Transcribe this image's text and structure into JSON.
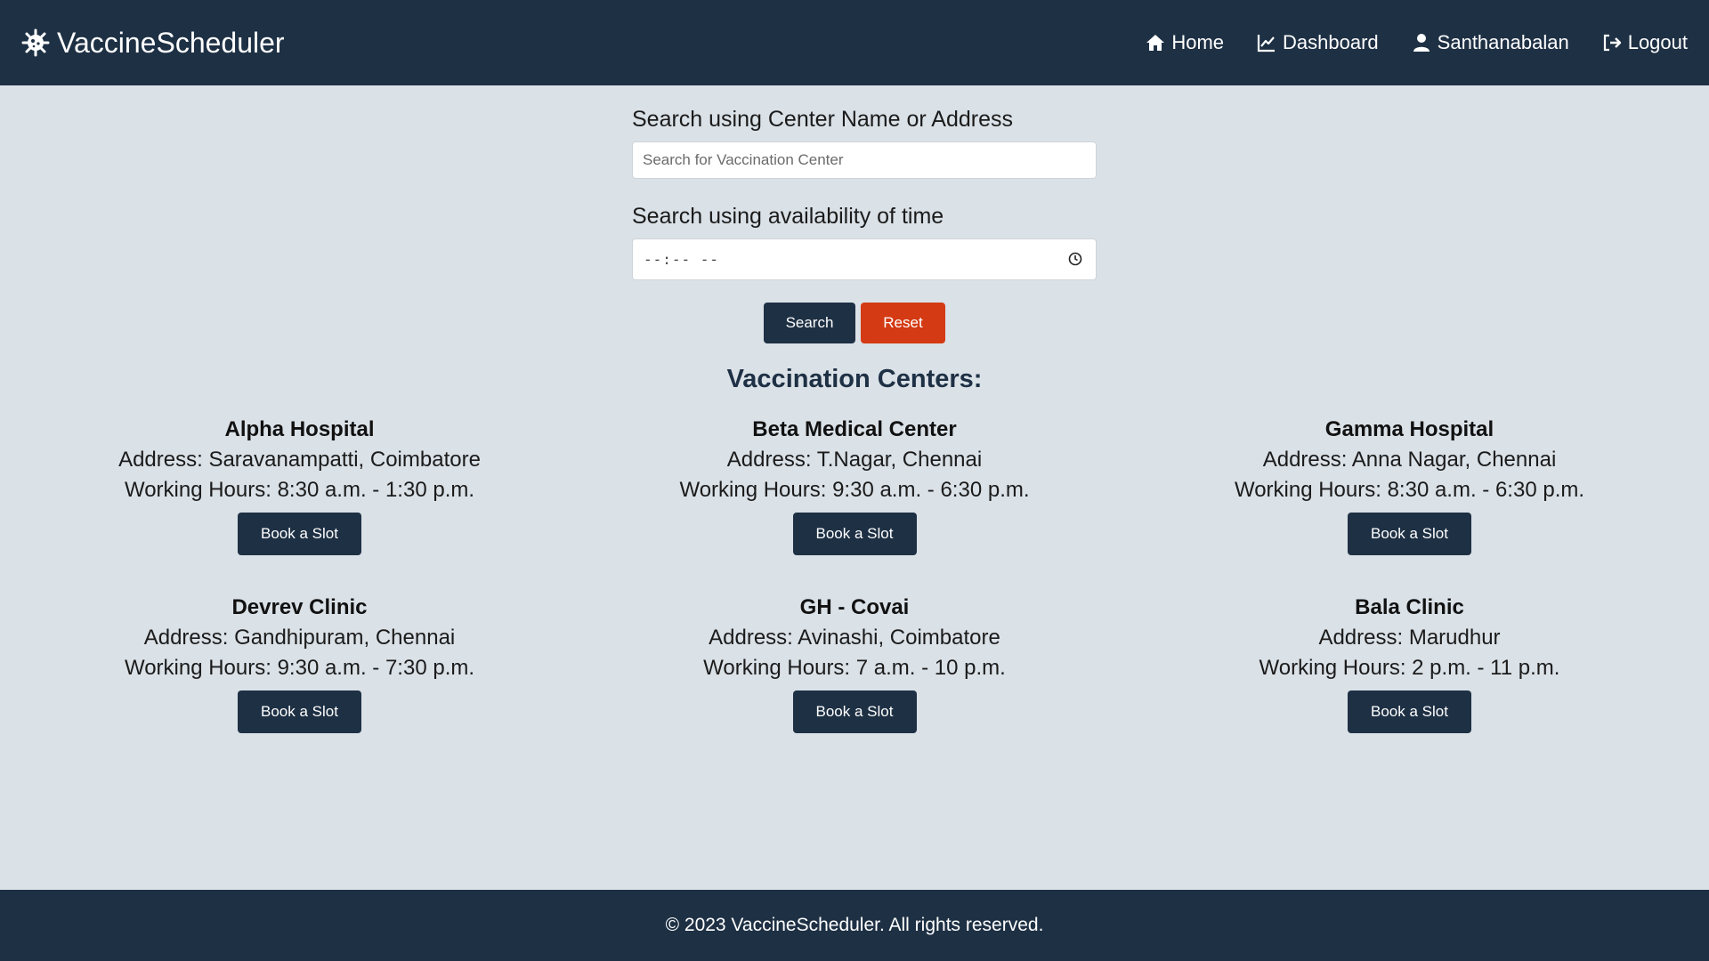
{
  "brand": {
    "name": "VaccineScheduler",
    "icon": "virus-icon"
  },
  "nav": [
    {
      "label": "Home",
      "icon": "home-icon"
    },
    {
      "label": "Dashboard",
      "icon": "chart-line-icon"
    },
    {
      "label": "Santhanabalan",
      "icon": "user-icon"
    },
    {
      "label": "Logout",
      "icon": "logout-icon"
    }
  ],
  "search": {
    "name_label": "Search using Center Name or Address",
    "name_placeholder": "Search for Vaccination Center",
    "time_label": "Search using availability of time",
    "time_value": "--:-- --",
    "search_button": "Search",
    "reset_button": "Reset"
  },
  "section_title": "Vaccination Centers:",
  "centers": [
    {
      "name": "Alpha Hospital",
      "address": "Address: Saravanampatti, Coimbatore",
      "hours": "Working Hours: 8:30 a.m. - 1:30 p.m.",
      "button": "Book a Slot"
    },
    {
      "name": "Beta Medical Center",
      "address": "Address: T.Nagar, Chennai",
      "hours": "Working Hours: 9:30 a.m. - 6:30 p.m.",
      "button": "Book a Slot"
    },
    {
      "name": "Gamma Hospital",
      "address": "Address: Anna Nagar, Chennai",
      "hours": "Working Hours: 8:30 a.m. - 6:30 p.m.",
      "button": "Book a Slot"
    },
    {
      "name": "Devrev Clinic",
      "address": "Address: Gandhipuram, Chennai",
      "hours": "Working Hours: 9:30 a.m. - 7:30 p.m.",
      "button": "Book a Slot"
    },
    {
      "name": "GH - Covai",
      "address": "Address: Avinashi, Coimbatore",
      "hours": "Working Hours: 7 a.m. - 10 p.m.",
      "button": "Book a Slot"
    },
    {
      "name": "Bala Clinic",
      "address": "Address: Marudhur",
      "hours": "Working Hours: 2 p.m. - 11 p.m.",
      "button": "Book a Slot"
    }
  ],
  "footer": {
    "text": "© 2023 VaccineScheduler. All rights reserved."
  },
  "colors": {
    "primary": "#1e3044",
    "reset": "#d43a13",
    "background": "#dae1e7"
  }
}
